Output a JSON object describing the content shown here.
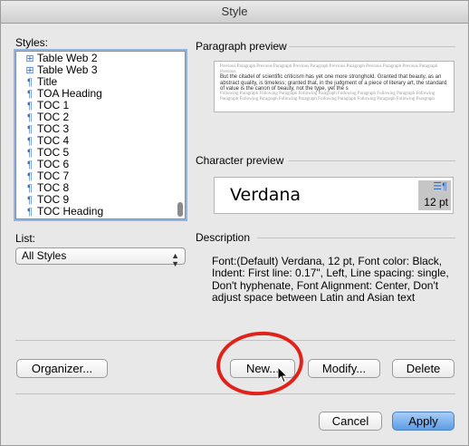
{
  "window": {
    "title": "Style"
  },
  "styles_panel": {
    "label": "Styles:",
    "items": [
      {
        "icon": "table-icon",
        "label": "Table Web 2"
      },
      {
        "icon": "table-icon",
        "label": "Table Web 3"
      },
      {
        "icon": "paragraph-icon",
        "label": "Title"
      },
      {
        "icon": "paragraph-icon",
        "label": "TOA Heading"
      },
      {
        "icon": "paragraph-icon",
        "label": "TOC 1"
      },
      {
        "icon": "paragraph-icon",
        "label": "TOC 2"
      },
      {
        "icon": "paragraph-icon",
        "label": "TOC 3"
      },
      {
        "icon": "paragraph-icon",
        "label": "TOC 4"
      },
      {
        "icon": "paragraph-icon",
        "label": "TOC 5"
      },
      {
        "icon": "paragraph-icon",
        "label": "TOC 6"
      },
      {
        "icon": "paragraph-icon",
        "label": "TOC 7"
      },
      {
        "icon": "paragraph-icon",
        "label": "TOC 8"
      },
      {
        "icon": "paragraph-icon",
        "label": "TOC 9"
      },
      {
        "icon": "paragraph-icon",
        "label": "TOC Heading"
      }
    ]
  },
  "list_panel": {
    "label": "List:",
    "selected": "All Styles"
  },
  "paragraph_preview": {
    "label": "Paragraph preview",
    "sample_text": "But the citadel of scientific criticism has yet one more stronghold. Granted that beauty, as an abstract quality, is timeless; granted that, in the judgment of a piece of literary art, the standard of value is the canon of beauty, not the type, yet the s"
  },
  "character_preview": {
    "label": "Character preview",
    "sample": "Verdana",
    "size": "12 pt"
  },
  "description": {
    "label": "Description",
    "text": "Font:(Default) Verdana, 12 pt, Font color: Black, Indent: First line:  0.17\", Left, Line spacing: single, Don't hyphenate, Font Alignment: Center, Don't adjust space between Latin and Asian text"
  },
  "buttons": {
    "organizer": "Organizer...",
    "new": "New...",
    "modify": "Modify...",
    "delete": "Delete",
    "cancel": "Cancel",
    "apply": "Apply"
  },
  "colors": {
    "accent": "#5d9ce5",
    "highlight_circle": "#e0231a",
    "icon_blue": "#3b6fc2"
  }
}
